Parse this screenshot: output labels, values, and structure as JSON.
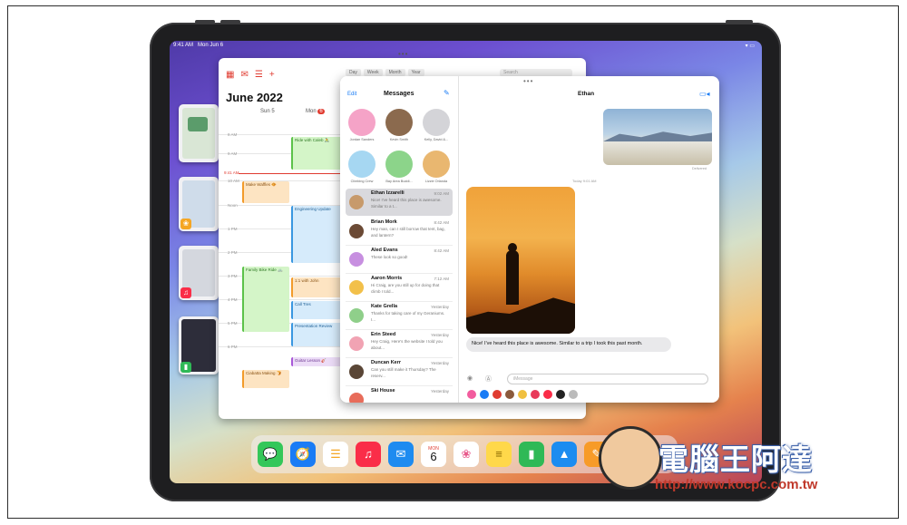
{
  "status_bar": {
    "time": "9:41 AM",
    "date": "Mon Jun 6",
    "battery": "100%"
  },
  "calendar": {
    "title": "June 2022",
    "view_tabs": [
      "Day",
      "Week",
      "Month",
      "Year"
    ],
    "search_placeholder": "Search",
    "days": {
      "sun": "Sun 5",
      "mon": "Mon",
      "mon_badge": "6"
    },
    "hours": [
      "8 AM",
      "9 AM",
      "10 AM",
      "Noon",
      "1 PM",
      "2 PM",
      "3 PM",
      "4 PM",
      "5 PM",
      "6 PM"
    ],
    "now_label": "9:41 AM",
    "events": [
      {
        "title": "Ride with Caleb 🚴",
        "color": "green"
      },
      {
        "title": "Make Waffles 🧇",
        "color": "orange"
      },
      {
        "title": "Engineering Update",
        "color": "blue"
      },
      {
        "title": "Family Bike Ride 🚲",
        "color": "green"
      },
      {
        "title": "1:1 with John",
        "color": "orange"
      },
      {
        "title": "Call Tres",
        "color": "blue"
      },
      {
        "title": "Presentation Review",
        "color": "blue"
      },
      {
        "title": "Guitar Lesson 🎸",
        "color": "purple"
      },
      {
        "title": "Ciabatta Making 🍞",
        "color": "orange"
      }
    ]
  },
  "messages": {
    "edit": "Edit",
    "title": "Messages",
    "pinned": [
      {
        "name": "Jordan Sanders",
        "color": "#f5a3c7"
      },
      {
        "name": "Kevin Smith",
        "color": "#8b6a4e"
      },
      {
        "name": "Kelly, David &...",
        "color": "#d4d4d8"
      },
      {
        "name": "Climbing Crew",
        "color": "#a6d7f2"
      },
      {
        "name": "Bay Area Buddi...",
        "color": "#8cd48a"
      },
      {
        "name": "Lizzie Orlanda",
        "color": "#e9b770"
      }
    ],
    "conversations": [
      {
        "name": "Ethan Izzarelli",
        "time": "9:02 AM",
        "preview": "Nice! I've heard this place is awesome. Similar to a t...",
        "selected": true
      },
      {
        "name": "Brian Mork",
        "time": "8:42 AM",
        "preview": "Hey man, can I still borrow that tent, bag, and lantern?"
      },
      {
        "name": "Aled Evans",
        "time": "8:42 AM",
        "preview": "These look so good!"
      },
      {
        "name": "Aaron Morris",
        "time": "7:12 AM",
        "preview": "Hi Craig, are you still up for doing that climb I told..."
      },
      {
        "name": "Kate Grella",
        "time": "Yesterday",
        "preview": "Thanks for taking care of my Geraniums. I..."
      },
      {
        "name": "Erin Steed",
        "time": "Yesterday",
        "preview": "Hey Craig, Here's the website I told you about..."
      },
      {
        "name": "Duncan Kerr",
        "time": "Yesterday",
        "preview": "Can you still make it Thursday? The reserv..."
      },
      {
        "name": "Ski House",
        "time": "Yesterday",
        "preview": ""
      }
    ],
    "chat": {
      "contact": "Ethan",
      "delivered": "Delivered",
      "timestamp": "Today 9:01 AM",
      "received_text": "Nice! I've heard this place is awesome. Similar to a trip I took this past month.",
      "input_placeholder": "iMessage"
    }
  },
  "dock": {
    "apps": [
      {
        "name": "messages",
        "color": "#34c759",
        "glyph": "💬"
      },
      {
        "name": "safari",
        "color": "#1a7cf5",
        "glyph": "🧭"
      },
      {
        "name": "reminders",
        "color": "#ffffff",
        "glyph": "☰"
      },
      {
        "name": "music",
        "color": "#fa2d48",
        "glyph": "♫"
      },
      {
        "name": "mail",
        "color": "#1e8bf0",
        "glyph": "✉"
      },
      {
        "name": "calendar",
        "color": "#ffffff",
        "glyph": "6"
      },
      {
        "name": "photos",
        "color": "#ffffff",
        "glyph": "❀"
      },
      {
        "name": "notes",
        "color": "#ffd84a",
        "glyph": "≡"
      },
      {
        "name": "numbers",
        "color": "#2fb956",
        "glyph": "▮"
      },
      {
        "name": "keynote",
        "color": "#1c8cf0",
        "glyph": "▲"
      },
      {
        "name": "pages",
        "color": "#f79b28",
        "glyph": "✎"
      }
    ],
    "calendar_month": "MON"
  },
  "watermark": {
    "brand": "電腦王阿達",
    "url": "http://www.kocpc.com.tw"
  }
}
